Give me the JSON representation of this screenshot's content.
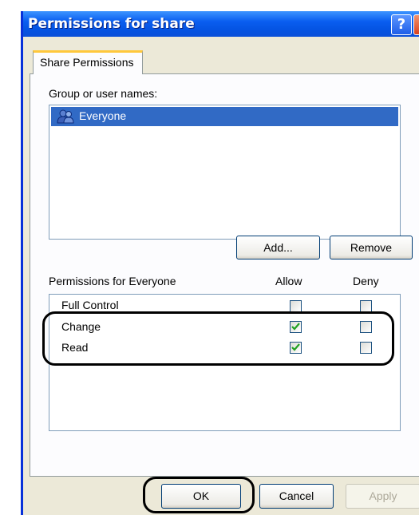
{
  "window": {
    "title": "Permissions for share",
    "help_label": "?",
    "close_label": "X"
  },
  "tabs": [
    {
      "label": "Share Permissions",
      "active": true
    }
  ],
  "users_section": {
    "label": "Group or user names:",
    "items": [
      {
        "name": "Everyone",
        "selected": true,
        "icon": "group-icon"
      }
    ]
  },
  "user_buttons": {
    "add_label": "Add...",
    "remove_label": "Remove"
  },
  "permissions": {
    "header_label": "Permissions for Everyone",
    "allow_header": "Allow",
    "deny_header": "Deny",
    "rows": [
      {
        "name": "Full Control",
        "allow": false,
        "deny": false
      },
      {
        "name": "Change",
        "allow": true,
        "deny": false
      },
      {
        "name": "Read",
        "allow": true,
        "deny": false
      }
    ]
  },
  "dialog_buttons": {
    "ok_label": "OK",
    "cancel_label": "Cancel",
    "apply_label": "Apply"
  },
  "colors": {
    "titlebar": "#0554e3",
    "selection": "#316ac5",
    "check": "#21a121",
    "dialog_bg": "#ece9d8"
  }
}
